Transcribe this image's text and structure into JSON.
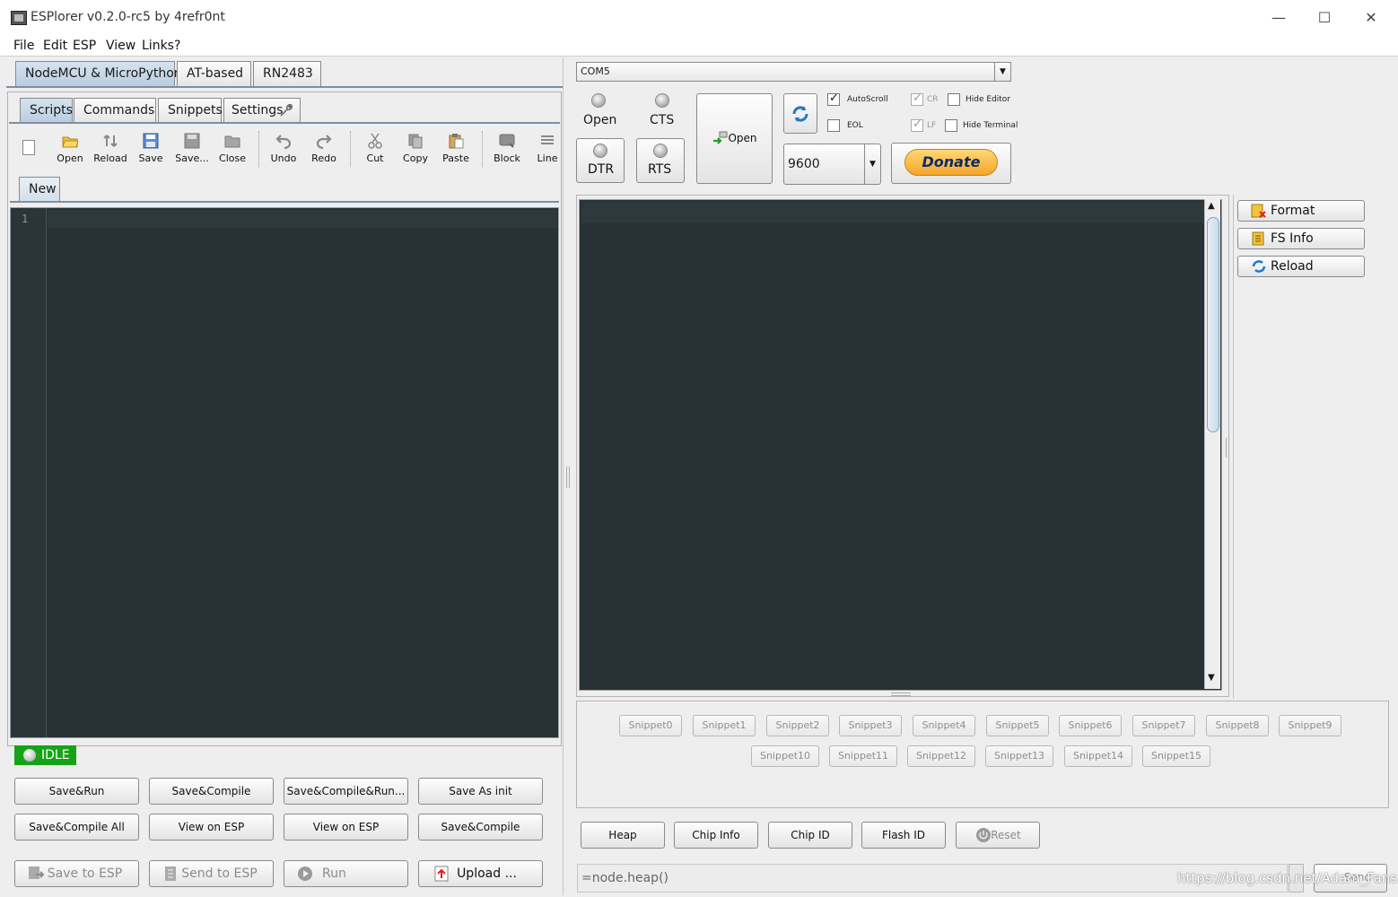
{
  "window": {
    "title": "ESPlorer v0.2.0-rc5 by 4refr0nt",
    "minimize": "—",
    "maximize": "☐",
    "close": "✕"
  },
  "menu": [
    "File",
    "Edit",
    "ESP",
    "View",
    "Links",
    "?"
  ],
  "firmware_tabs": [
    "NodeMCU & MicroPython",
    "AT-based",
    "RN2483"
  ],
  "editor_tabs": [
    "Scripts",
    "Commands",
    "Snippets",
    "Settings"
  ],
  "toolbar": [
    {
      "label": "Open",
      "icon": "folder-open-icon"
    },
    {
      "label": "Reload",
      "icon": "reload-icon"
    },
    {
      "label": "Save",
      "icon": "floppy-disk-icon"
    },
    {
      "label": "Save...",
      "icon": "save-as-icon"
    },
    {
      "label": "Close",
      "icon": "close-file-icon"
    },
    {
      "label": "Undo",
      "icon": "undo-icon"
    },
    {
      "label": "Redo",
      "icon": "redo-icon"
    },
    {
      "label": "Cut",
      "icon": "scissors-icon"
    },
    {
      "label": "Copy",
      "icon": "copy-icon"
    },
    {
      "label": "Paste",
      "icon": "paste-icon"
    },
    {
      "label": "Block",
      "icon": "block-icon"
    },
    {
      "label": "Line",
      "icon": "line-icon"
    }
  ],
  "file_tab": "New",
  "editor": {
    "line_number": "1"
  },
  "status": "IDLE",
  "script_buttons_row1": [
    "Save&Run",
    "Save&Compile",
    "Save&Compile&Run...",
    "Save As init"
  ],
  "script_buttons_row2": [
    "Save&Compile All",
    "View on ESP",
    "View on ESP",
    "Save&Compile"
  ],
  "script_buttons_row3": [
    "Save to ESP",
    "Send to ESP",
    "Run",
    "Upload ..."
  ],
  "port": "COM5",
  "signals": {
    "open": "Open",
    "cts": "CTS",
    "dtr": "DTR",
    "rts": "RTS"
  },
  "open_button": "Open",
  "baud": "9600",
  "checkboxes": [
    {
      "label": "AutoScroll",
      "checked": true,
      "enabled": true
    },
    {
      "label": "EOL",
      "checked": false,
      "enabled": true
    },
    {
      "label": "CR",
      "checked": true,
      "enabled": false
    },
    {
      "label": "LF",
      "checked": true,
      "enabled": false
    },
    {
      "label": "Hide Editor",
      "checked": false,
      "enabled": true
    },
    {
      "label": "Hide Terminal",
      "checked": false,
      "enabled": true
    }
  ],
  "donate": "Donate",
  "side_buttons": [
    "Format",
    "FS Info",
    "Reload"
  ],
  "snippets_row1": [
    "Snippet0",
    "Snippet1",
    "Snippet2",
    "Snippet3",
    "Snippet4",
    "Snippet5",
    "Snippet6",
    "Snippet7",
    "Snippet8",
    "Snippet9"
  ],
  "snippets_row2": [
    "Snippet10",
    "Snippet11",
    "Snippet12",
    "Snippet13",
    "Snippet14",
    "Snippet15"
  ],
  "esp_buttons": [
    "Heap",
    "Chip Info",
    "Chip ID",
    "Flash ID",
    "Reset"
  ],
  "command": "=node.heap()",
  "send_button": "Send",
  "watermark": "https://blog.csdn.net/Adam_Fans"
}
